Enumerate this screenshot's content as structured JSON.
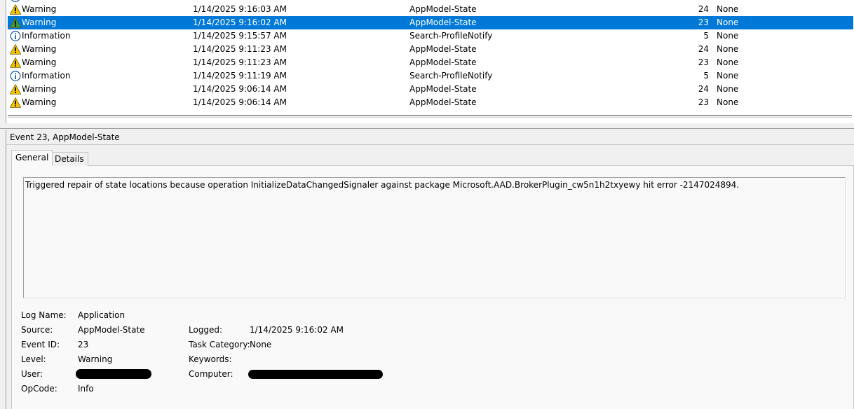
{
  "events": [
    {
      "level": "Warning",
      "icon": "warning-icon",
      "date": "1/14/2025 9:16:03 AM",
      "source": "AppModel-State",
      "event_id": "24",
      "task_category": "None",
      "selected": false
    },
    {
      "level": "Warning",
      "icon": "warning-icon",
      "date": "1/14/2025 9:16:02 AM",
      "source": "AppModel-State",
      "event_id": "23",
      "task_category": "None",
      "selected": true
    },
    {
      "level": "Information",
      "icon": "information-icon",
      "date": "1/14/2025 9:15:57 AM",
      "source": "Search-ProfileNotify",
      "event_id": "5",
      "task_category": "None",
      "selected": false
    },
    {
      "level": "Warning",
      "icon": "warning-icon",
      "date": "1/14/2025 9:11:23 AM",
      "source": "AppModel-State",
      "event_id": "24",
      "task_category": "None",
      "selected": false
    },
    {
      "level": "Warning",
      "icon": "warning-icon",
      "date": "1/14/2025 9:11:23 AM",
      "source": "AppModel-State",
      "event_id": "23",
      "task_category": "None",
      "selected": false
    },
    {
      "level": "Information",
      "icon": "information-icon",
      "date": "1/14/2025 9:11:19 AM",
      "source": "Search-ProfileNotify",
      "event_id": "5",
      "task_category": "None",
      "selected": false
    },
    {
      "level": "Warning",
      "icon": "warning-icon",
      "date": "1/14/2025 9:06:14 AM",
      "source": "AppModel-State",
      "event_id": "24",
      "task_category": "None",
      "selected": false
    },
    {
      "level": "Warning",
      "icon": "warning-icon",
      "date": "1/14/2025 9:06:14 AM",
      "source": "AppModel-State",
      "event_id": "23",
      "task_category": "None",
      "selected": false
    }
  ],
  "details": {
    "header": "Event 23, AppModel-State",
    "tabs": [
      "General",
      "Details"
    ],
    "active_tab": "General",
    "description": "Triggered repair of state locations because operation InitializeDataChangedSignaler against package Microsoft.AAD.BrokerPlugin_cw5n1h2txyewy hit error -2147024894.",
    "labels": {
      "log_name": "Log Name:",
      "source": "Source:",
      "event_id": "Event ID:",
      "level": "Level:",
      "user": "User:",
      "opcode": "OpCode:",
      "logged": "Logged:",
      "task_category": "Task Category:",
      "keywords": "Keywords:",
      "computer": "Computer:"
    },
    "values": {
      "log_name": "Application",
      "source": "AppModel-State",
      "event_id": "23",
      "level": "Warning",
      "user": "",
      "opcode": "Info",
      "logged": "1/14/2025 9:16:02 AM",
      "task_category": "None",
      "keywords": "",
      "computer": ""
    }
  },
  "colors": {
    "selection": "#0078d7",
    "warning": "#f5c400",
    "info": "#1f5fa8"
  }
}
